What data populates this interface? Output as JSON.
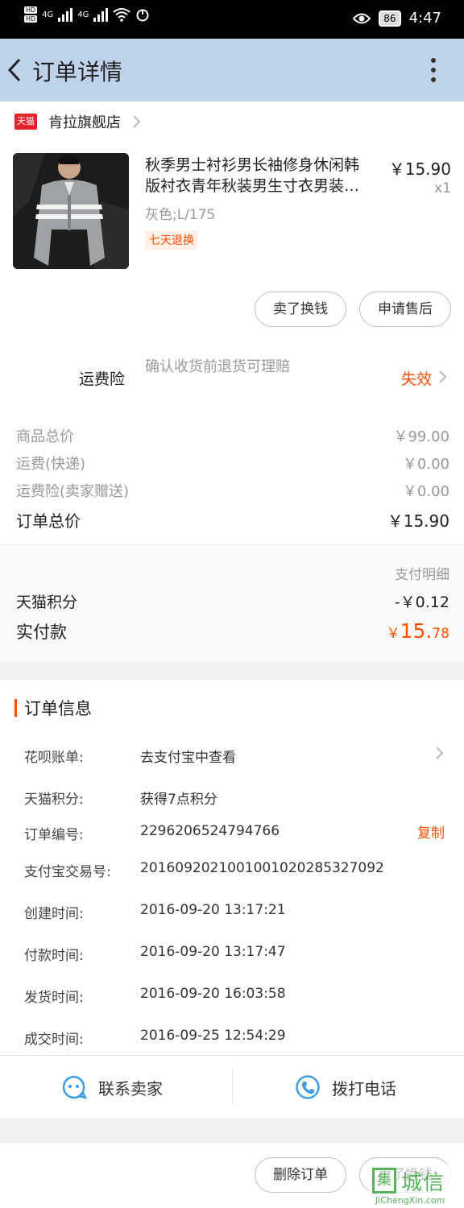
{
  "status_bar": {
    "hd1": "HD",
    "hd2": "HD",
    "net1": "4G",
    "net2": "4G",
    "battery": "86",
    "time": "4:47"
  },
  "header": {
    "title": "订单详情"
  },
  "shop": {
    "logo_text": "天猫",
    "name": "肯拉旗舰店"
  },
  "product": {
    "title_line1": "秋季男士衬衫男长袖修身休闲韩",
    "title_line2": "版衬衣青年秋装男生寸衣男装…",
    "price": "￥15.90",
    "quantity": "x1",
    "sku": "灰色;L/175",
    "tag": "七天退换",
    "sell_button": "卖了换钱",
    "aftersale_button": "申请售后"
  },
  "insurance": {
    "label": "运费险",
    "desc": "确认收货前退货可理赔",
    "status": "失效"
  },
  "summary": {
    "goods_total_label": "商品总价",
    "goods_total": "￥99.00",
    "shipping_label": "运费(快递)",
    "shipping": "￥0.00",
    "ins_fee_label": "运费险(卖家赠送)",
    "ins_fee": "￥0.00",
    "order_total_label": "订单总价",
    "order_total": "￥15.90"
  },
  "payment": {
    "detail_link": "支付明细",
    "points_label": "天猫积分",
    "points_value": "-￥0.12",
    "paid_label": "实付款",
    "paid_currency": "￥",
    "paid_int": "15.",
    "paid_dec": "78"
  },
  "order_info": {
    "title": "订单信息",
    "rows": [
      {
        "key": "花呗账单:",
        "value": "去支付宝中查看"
      },
      {
        "key": "天猫积分:",
        "value": "获得7点积分"
      },
      {
        "key": "订单编号:",
        "value": "2296206524794766"
      },
      {
        "key": "支付宝交易号:",
        "value": "2016092021001001020285327092"
      },
      {
        "key": "创建时间:",
        "value": "2016-09-20 13:17:21"
      },
      {
        "key": "付款时间:",
        "value": "2016-09-20 13:17:47"
      },
      {
        "key": "发货时间:",
        "value": "2016-09-20 16:03:58"
      },
      {
        "key": "成交时间:",
        "value": "2016-09-25 12:54:29"
      }
    ],
    "copy_label": "复制"
  },
  "contact": {
    "seller_label": "联系卖家",
    "call_label": "拨打电话"
  },
  "bottom": {
    "delete_button": "删除订单",
    "sell_button": "卖了换钱"
  },
  "watermark": {
    "cn": "城信",
    "box": "集",
    "en": "JiChengXin.com"
  },
  "colors": {
    "accent": "#ff5000",
    "header_bg": "#bed3ea",
    "contact_icon": "#3a9ee4",
    "tmall_red": "#e5222c"
  }
}
